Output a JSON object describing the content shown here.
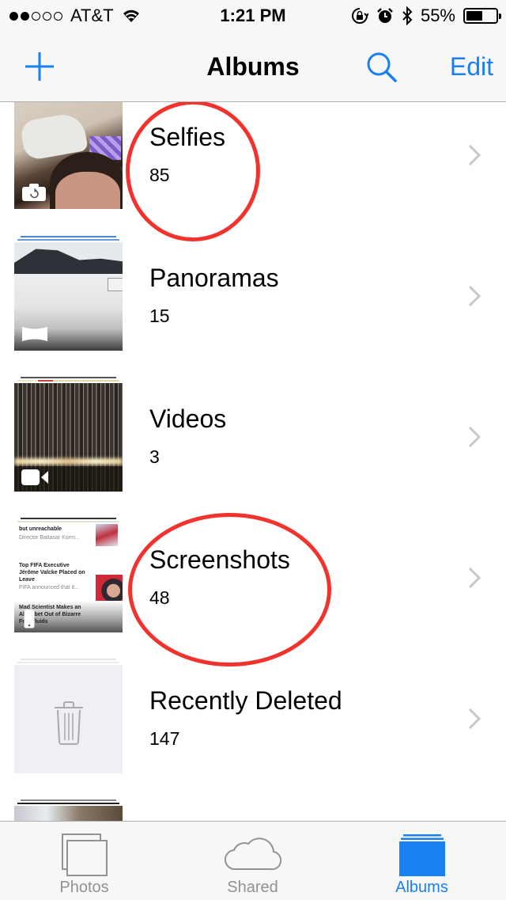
{
  "status_bar": {
    "signal_bars_filled": 2,
    "signal_bars_total": 5,
    "carrier": "AT&T",
    "time": "1:21 PM",
    "battery_percent_label": "55%",
    "battery_level": 0.55,
    "icons": [
      "wifi-icon",
      "rotation-lock-icon",
      "alarm-icon",
      "bluetooth-icon",
      "battery-icon"
    ]
  },
  "nav": {
    "title": "Albums",
    "add_icon": "plus-icon",
    "search_icon": "search-icon",
    "edit_label": "Edit"
  },
  "albums": [
    {
      "name": "Selfies",
      "count": "85",
      "badge": "front-camera-icon",
      "highlighted": true
    },
    {
      "name": "Panoramas",
      "count": "15",
      "badge": "panorama-icon",
      "highlighted": false
    },
    {
      "name": "Videos",
      "count": "3",
      "badge": "video-camera-icon",
      "highlighted": false
    },
    {
      "name": "Screenshots",
      "count": "48",
      "badge": "screenshot-icon",
      "highlighted": true
    },
    {
      "name": "Recently Deleted",
      "count": "147",
      "badge": "trash-icon",
      "highlighted": false
    }
  ],
  "screenshot_thumb_text": [
    "but unreachable",
    "Director Baltasar Korm...",
    "Top FIFA Executive Jérôme Valcke Placed on Leave",
    "FIFA announced that it...",
    "Mad Scientist Makes an Alphabet Out of Bizarre Ferrofluids"
  ],
  "tab_bar": {
    "tabs": [
      {
        "label": "Photos",
        "icon": "photos-icon",
        "active": false
      },
      {
        "label": "Shared",
        "icon": "cloud-icon",
        "active": false
      },
      {
        "label": "Albums",
        "icon": "albums-icon",
        "active": true
      }
    ]
  },
  "colors": {
    "accent": "#1a7ff0",
    "annotation_circle": "#f2322c",
    "inactive_tab": "#929292"
  }
}
